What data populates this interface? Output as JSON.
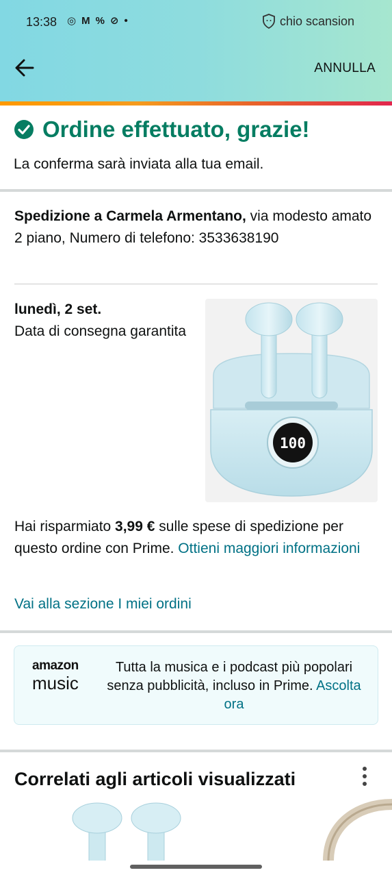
{
  "status_bar": {
    "time": "13:38",
    "icons": [
      "whatsapp-icon",
      "gmail-icon",
      "app-icon",
      "alert-icon",
      "dot-icon"
    ],
    "right_text": "chio scansion"
  },
  "header": {
    "back_icon": "arrow-left-icon",
    "cancel_label": "ANNULLA"
  },
  "confirmation": {
    "title": "Ordine effettuato, grazie!",
    "subtitle": "La conferma sarà inviata alla tua email."
  },
  "shipping": {
    "recipient_bold": "Spedizione a Carmela Armentano,",
    "address": " via modesto amato 2 piano, Numero di telefono: 3533638190"
  },
  "delivery": {
    "date": "lunedì, 2 set.",
    "note": "Data di consegna garantita",
    "product_image": "wireless-earbuds-image"
  },
  "savings": {
    "prefix": "Hai risparmiato ",
    "amount": "3,99 €",
    "suffix": " sulle spese di spedizione per questo ordine con Prime. ",
    "link": "Ottieni maggiori informazioni"
  },
  "orders_link": "Vai alla sezione I miei ordini",
  "music_promo": {
    "logo_top": "amazon",
    "logo_bottom": "music",
    "text": "Tutta la musica e i podcast più popolari senza pubblicità, incluso in Prime. ",
    "link": "Ascolta ora"
  },
  "related": {
    "title": "Correlati agli articoli visualizzati",
    "menu_icon": "kebab-icon"
  },
  "colors": {
    "success_green": "#067d62",
    "link_teal": "#007185",
    "header_gradient_start": "#82d8e3",
    "header_gradient_end": "#a6e6cf"
  }
}
